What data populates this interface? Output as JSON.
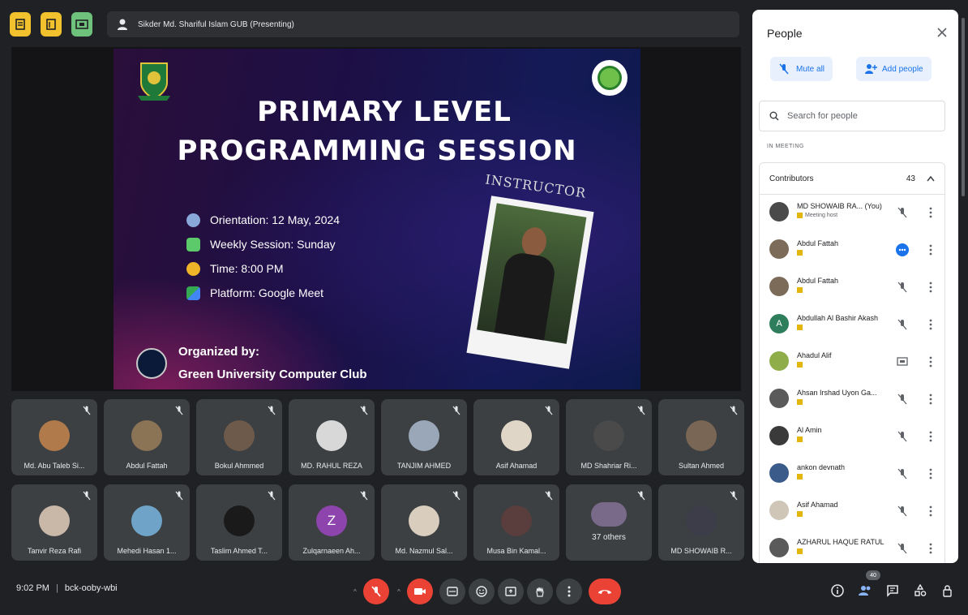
{
  "top": {
    "presenting_text": "Sikder Md. Shariful Islam GUB (Presenting)",
    "left_buttons": [
      "sheet-icon",
      "doc-icon",
      "present-icon"
    ]
  },
  "slide": {
    "title_line1": "PRIMARY LEVEL",
    "title_line2": "PROGRAMMING SESSION",
    "info": [
      {
        "label": "Orientation: 12 May, 2024",
        "icon": "calendar-icon",
        "color": "#8aa7d9"
      },
      {
        "label": "Weekly Session: Sunday",
        "icon": "board-icon",
        "color": "#5cc96a"
      },
      {
        "label": "Time: 8:00 PM",
        "icon": "clock-icon",
        "color": "#f0b429"
      },
      {
        "label": "Platform: Google Meet",
        "icon": "meet-icon",
        "color": "#4285f4"
      }
    ],
    "organized_line1": "Organized by:",
    "organized_line2": "Green University Computer Club",
    "instructor_label": "INSTRUCTOR"
  },
  "tiles": [
    {
      "name": "Md. Abu Taleb Si...",
      "avatar_color": "#b07a4a",
      "avatar_text": ""
    },
    {
      "name": "Abdul Fattah",
      "avatar_color": "#8b7355",
      "avatar_text": ""
    },
    {
      "name": "Bokul Ahmmed",
      "avatar_color": "#6d5a4a",
      "avatar_text": ""
    },
    {
      "name": "MD. RAHUL REZA",
      "avatar_color": "#d8d8d8",
      "avatar_text": ""
    },
    {
      "name": "TANJIM AHMED",
      "avatar_color": "#9aa7b8",
      "avatar_text": ""
    },
    {
      "name": "Asif Ahamad",
      "avatar_color": "#e0d6c8",
      "avatar_text": ""
    },
    {
      "name": "MD Shahriar Ri...",
      "avatar_color": "#4a4a4a",
      "avatar_text": ""
    },
    {
      "name": "Sultan Ahmed",
      "avatar_color": "#7a6655",
      "avatar_text": ""
    },
    {
      "name": "Tanvir Reza Rafi",
      "avatar_color": "#c9b7a8",
      "avatar_text": ""
    },
    {
      "name": "Mehedi Hasan 1...",
      "avatar_color": "#6fa3c7",
      "avatar_text": ""
    },
    {
      "name": "Taslim Ahmed T...",
      "avatar_color": "#1a1a1a",
      "avatar_text": ""
    },
    {
      "name": "Zulqarnaeen Ah...",
      "avatar_color": "#8e44ad",
      "avatar_text": "Z"
    },
    {
      "name": "Md. Nazmul Sal...",
      "avatar_color": "#d9cdbd",
      "avatar_text": ""
    },
    {
      "name": "Musa Bin Kamal...",
      "avatar_color": "#5a3d3d",
      "avatar_text": ""
    },
    {
      "name": "37 others",
      "avatar_color": "#7a6a8a",
      "avatar_text": ""
    },
    {
      "name": "MD SHOWAIB R...",
      "avatar_color": "#3d3d4a",
      "avatar_text": ""
    }
  ],
  "bottom": {
    "time": "9:02 PM",
    "meeting_code": "bck-ooby-wbi",
    "people_badge": "40"
  },
  "panel": {
    "title": "People",
    "mute_all": "Mute all",
    "add_people": "Add people",
    "search_placeholder": "Search for people",
    "section_label": "IN MEETING",
    "contributors_label": "Contributors",
    "contributors_count": "43",
    "people": [
      {
        "name": "MD SHOWAIB RA... (You)",
        "sub": "Meeting host",
        "avatar_color": "#4a4a4a",
        "avatar_text": "",
        "status": "mic-off-icon"
      },
      {
        "name": "Abdul Fattah",
        "sub": "",
        "avatar_color": "#7d6b5a",
        "avatar_text": "",
        "status": "more-audio-icon"
      },
      {
        "name": "Abdul Fattah",
        "sub": "",
        "avatar_color": "#7d6b5a",
        "avatar_text": "",
        "status": "mic-off-icon"
      },
      {
        "name": "Abdullah Al Bashir Akash",
        "sub": "",
        "avatar_color": "#2e7d5b",
        "avatar_text": "A",
        "status": "mic-off-icon"
      },
      {
        "name": "Ahadul Alif",
        "sub": "",
        "avatar_color": "#8fae4a",
        "avatar_text": "",
        "status": "present-icon"
      },
      {
        "name": "Ahsan Irshad Uyon Ga...",
        "sub": "",
        "avatar_color": "#5a5a5a",
        "avatar_text": "",
        "status": "mic-off-icon"
      },
      {
        "name": "Al Amin",
        "sub": "",
        "avatar_color": "#3a3a3a",
        "avatar_text": "",
        "status": "mic-off-icon"
      },
      {
        "name": "ankon devnath",
        "sub": "",
        "avatar_color": "#3b5b8a",
        "avatar_text": "",
        "status": "mic-off-icon"
      },
      {
        "name": "Asif Ahamad",
        "sub": "",
        "avatar_color": "#d0c6b8",
        "avatar_text": "",
        "status": "mic-off-icon"
      },
      {
        "name": "AZHARUL HAQUE RATUL",
        "sub": "",
        "avatar_color": "#5a5a5a",
        "avatar_text": "",
        "status": "mic-off-icon"
      }
    ]
  }
}
